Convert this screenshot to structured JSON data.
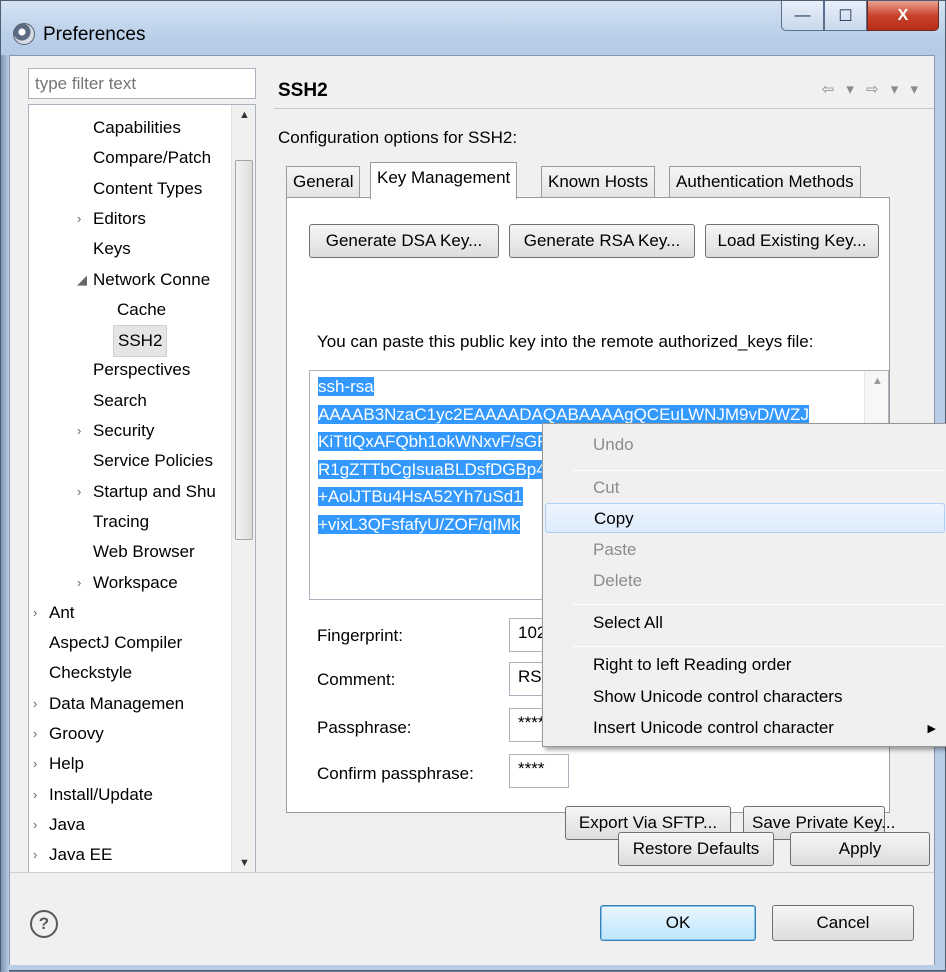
{
  "window": {
    "title": "Preferences"
  },
  "controls": {
    "minimize": "—",
    "maximize": "☐",
    "close": "X"
  },
  "filter": {
    "placeholder": "type filter text"
  },
  "tree": [
    {
      "label": "Capabilities",
      "level": 1,
      "twisty": ""
    },
    {
      "label": "Compare/Patch",
      "level": 1,
      "twisty": ""
    },
    {
      "label": "Content Types",
      "level": 1,
      "twisty": ""
    },
    {
      "label": "Editors",
      "level": 1,
      "twisty": "›"
    },
    {
      "label": "Keys",
      "level": 1,
      "twisty": ""
    },
    {
      "label": "Network Conne",
      "level": 1,
      "twisty": "◢"
    },
    {
      "label": "Cache",
      "level": 2,
      "twisty": ""
    },
    {
      "label": "SSH2",
      "level": 2,
      "twisty": "",
      "selected": true
    },
    {
      "label": "Perspectives",
      "level": 1,
      "twisty": ""
    },
    {
      "label": "Search",
      "level": 1,
      "twisty": ""
    },
    {
      "label": "Security",
      "level": 1,
      "twisty": "›"
    },
    {
      "label": "Service Policies",
      "level": 1,
      "twisty": ""
    },
    {
      "label": "Startup and Shu",
      "level": 1,
      "twisty": "›"
    },
    {
      "label": "Tracing",
      "level": 1,
      "twisty": ""
    },
    {
      "label": "Web Browser",
      "level": 1,
      "twisty": ""
    },
    {
      "label": "Workspace",
      "level": 1,
      "twisty": "›"
    },
    {
      "label": "Ant",
      "level": 0,
      "twisty": "›"
    },
    {
      "label": "AspectJ Compiler",
      "level": 0,
      "twisty": ""
    },
    {
      "label": "Checkstyle",
      "level": 0,
      "twisty": ""
    },
    {
      "label": "Data Managemen",
      "level": 0,
      "twisty": "›"
    },
    {
      "label": "Groovy",
      "level": 0,
      "twisty": "›"
    },
    {
      "label": "Help",
      "level": 0,
      "twisty": "›"
    },
    {
      "label": "Install/Update",
      "level": 0,
      "twisty": "›"
    },
    {
      "label": "Java",
      "level": 0,
      "twisty": "›"
    },
    {
      "label": "Java EE",
      "level": 0,
      "twisty": "›"
    }
  ],
  "page": {
    "title": "SSH2",
    "nav_arrows": "⇦ ▾ ⇨ ▾ ▾",
    "config_label": "Configuration options for SSH2:",
    "tabs": [
      "General",
      "Key Management",
      "Known Hosts",
      "Authentication Methods"
    ],
    "active_tab": "Key Management"
  },
  "key_management": {
    "buttons": [
      "Generate DSA Key...",
      "Generate RSA Key...",
      "Load Existing Key..."
    ],
    "paste_label": "You can paste this public key into the remote authorized_keys file:",
    "key_lines": [
      "ssh-rsa",
      "AAAAB3NzaC1yc2EAAAADAQABAAAAgQCEuLWNJM9vD/WZJ",
      "KiTtlQxAFQbh1okWNxvF/sGFfEVN9VAHJ9881eyr/WNS3+DibbRI",
      "R1gZTTbCgIsuaBLDsfDGBp4Hs3AnEkNv",
      "+AolJTBu4HsA52Yh7uSd1",
      "+vixL3QFsfafyU/ZOF/qIMk"
    ],
    "fields": [
      {
        "label": "Fingerprint:",
        "value": "102"
      },
      {
        "label": "Comment:",
        "value": "RSA"
      },
      {
        "label": "Passphrase:",
        "value": "****"
      },
      {
        "label": "Confirm passphrase:",
        "value": "****"
      }
    ],
    "bottom_buttons": [
      "Export Via SFTP...",
      "Save Private Key..."
    ]
  },
  "actions": {
    "restore_defaults": "Restore Defaults",
    "apply": "Apply",
    "ok": "OK",
    "cancel": "Cancel",
    "help": "?"
  },
  "context_menu": {
    "items": [
      {
        "label": "Undo",
        "enabled": false
      },
      {
        "sep": true
      },
      {
        "label": "Cut",
        "enabled": false
      },
      {
        "label": "Copy",
        "enabled": true,
        "hot": true
      },
      {
        "label": "Paste",
        "enabled": false
      },
      {
        "label": "Delete",
        "enabled": false
      },
      {
        "sep": true
      },
      {
        "label": "Select All",
        "enabled": true
      },
      {
        "sep": true
      },
      {
        "label": "Right to left Reading order",
        "enabled": true
      },
      {
        "label": "Show Unicode control characters",
        "enabled": true
      },
      {
        "label": "Insert Unicode control character",
        "enabled": true,
        "submenu": true
      }
    ]
  },
  "colors": {
    "selection": "#3399ff",
    "menu_hot": "#dcebfc"
  }
}
